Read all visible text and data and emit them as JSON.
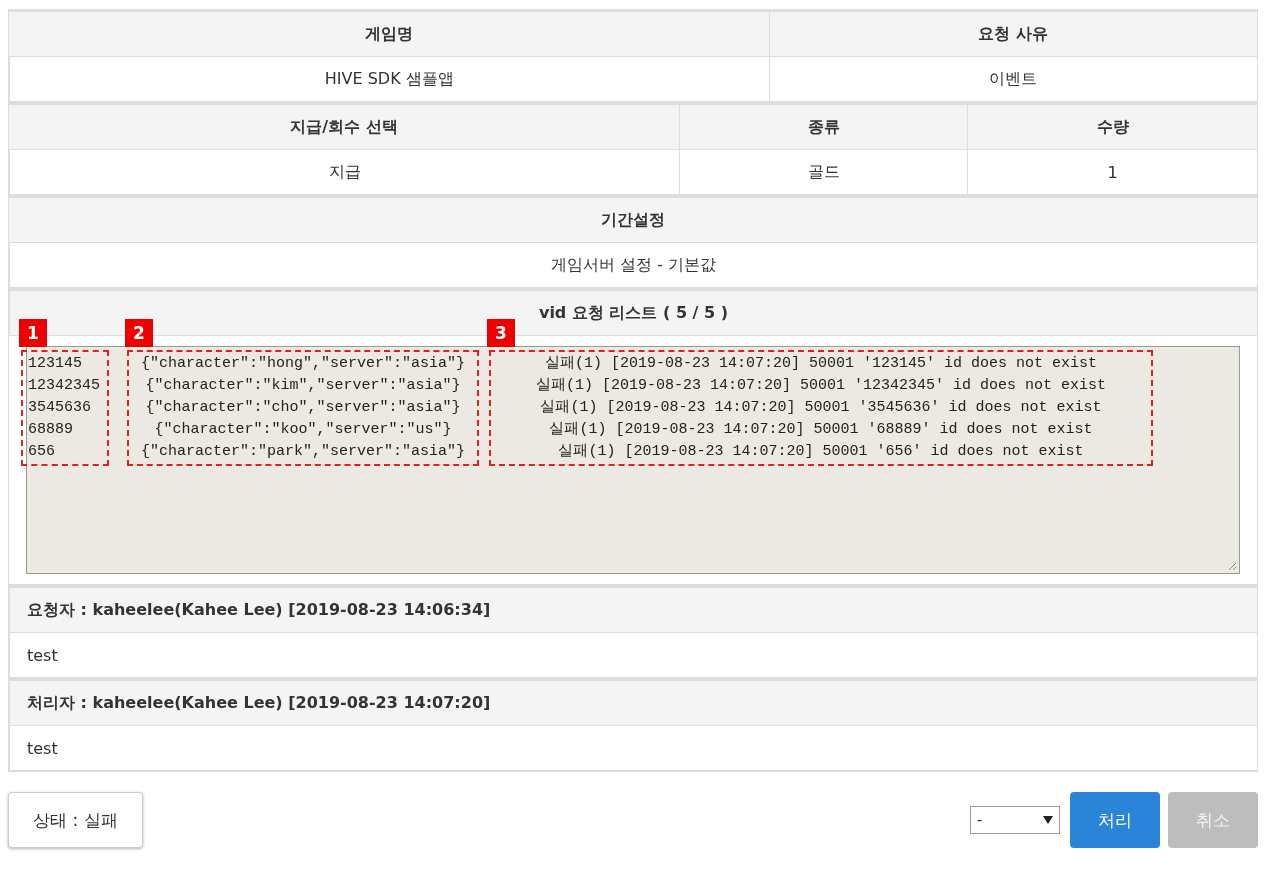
{
  "game_table": {
    "columns": [
      "게임명",
      "요청 사유"
    ],
    "values": [
      "HIVE SDK 샘플앱",
      "이벤트"
    ]
  },
  "item_table": {
    "columns": [
      "지급/회수 선택",
      "종류",
      "수량"
    ],
    "values": [
      "지급",
      "골드",
      "1"
    ]
  },
  "period_table": {
    "columns": [
      "기간설정"
    ],
    "values": [
      "게임서버 설정 - 기본값"
    ]
  },
  "vid_list": {
    "title": "vid 요청 리스트 ( 5 / 5 )",
    "annotations": [
      {
        "label": "1",
        "lines": [
          "123145",
          "12342345",
          "3545636",
          "68889",
          "656"
        ]
      },
      {
        "label": "2",
        "lines": [
          "{\"character\":\"hong\",\"server\":\"asia\"}",
          "{\"character\":\"kim\",\"server\":\"asia\"}",
          "{\"character\":\"cho\",\"server\":\"asia\"}",
          "{\"character\":\"koo\",\"server\":\"us\"}",
          "{\"character\":\"park\",\"server\":\"asia\"}"
        ]
      },
      {
        "label": "3",
        "lines": [
          "실패(1) [2019-08-23 14:07:20] 50001 '123145' id does not exist",
          "실패(1) [2019-08-23 14:07:20] 50001 '12342345' id does not exist",
          "실패(1) [2019-08-23 14:07:20] 50001 '3545636' id does not exist",
          "실패(1) [2019-08-23 14:07:20] 50001 '68889' id does not exist",
          "실패(1) [2019-08-23 14:07:20] 50001 '656' id does not exist"
        ]
      }
    ]
  },
  "comments": [
    {
      "header": "요청자 : kaheelee(Kahee Lee) [2019-08-23 14:06:34]",
      "body": "test"
    },
    {
      "header": "처리자 : kaheelee(Kahee Lee) [2019-08-23 14:07:20]",
      "body": "test"
    }
  ],
  "status_button": "상태 : 실패",
  "select": {
    "value": "-"
  },
  "buttons": [
    {
      "label": "처리",
      "kind": "primary",
      "disabled": false
    },
    {
      "label": "취소",
      "kind": "secondary",
      "disabled": true
    }
  ]
}
